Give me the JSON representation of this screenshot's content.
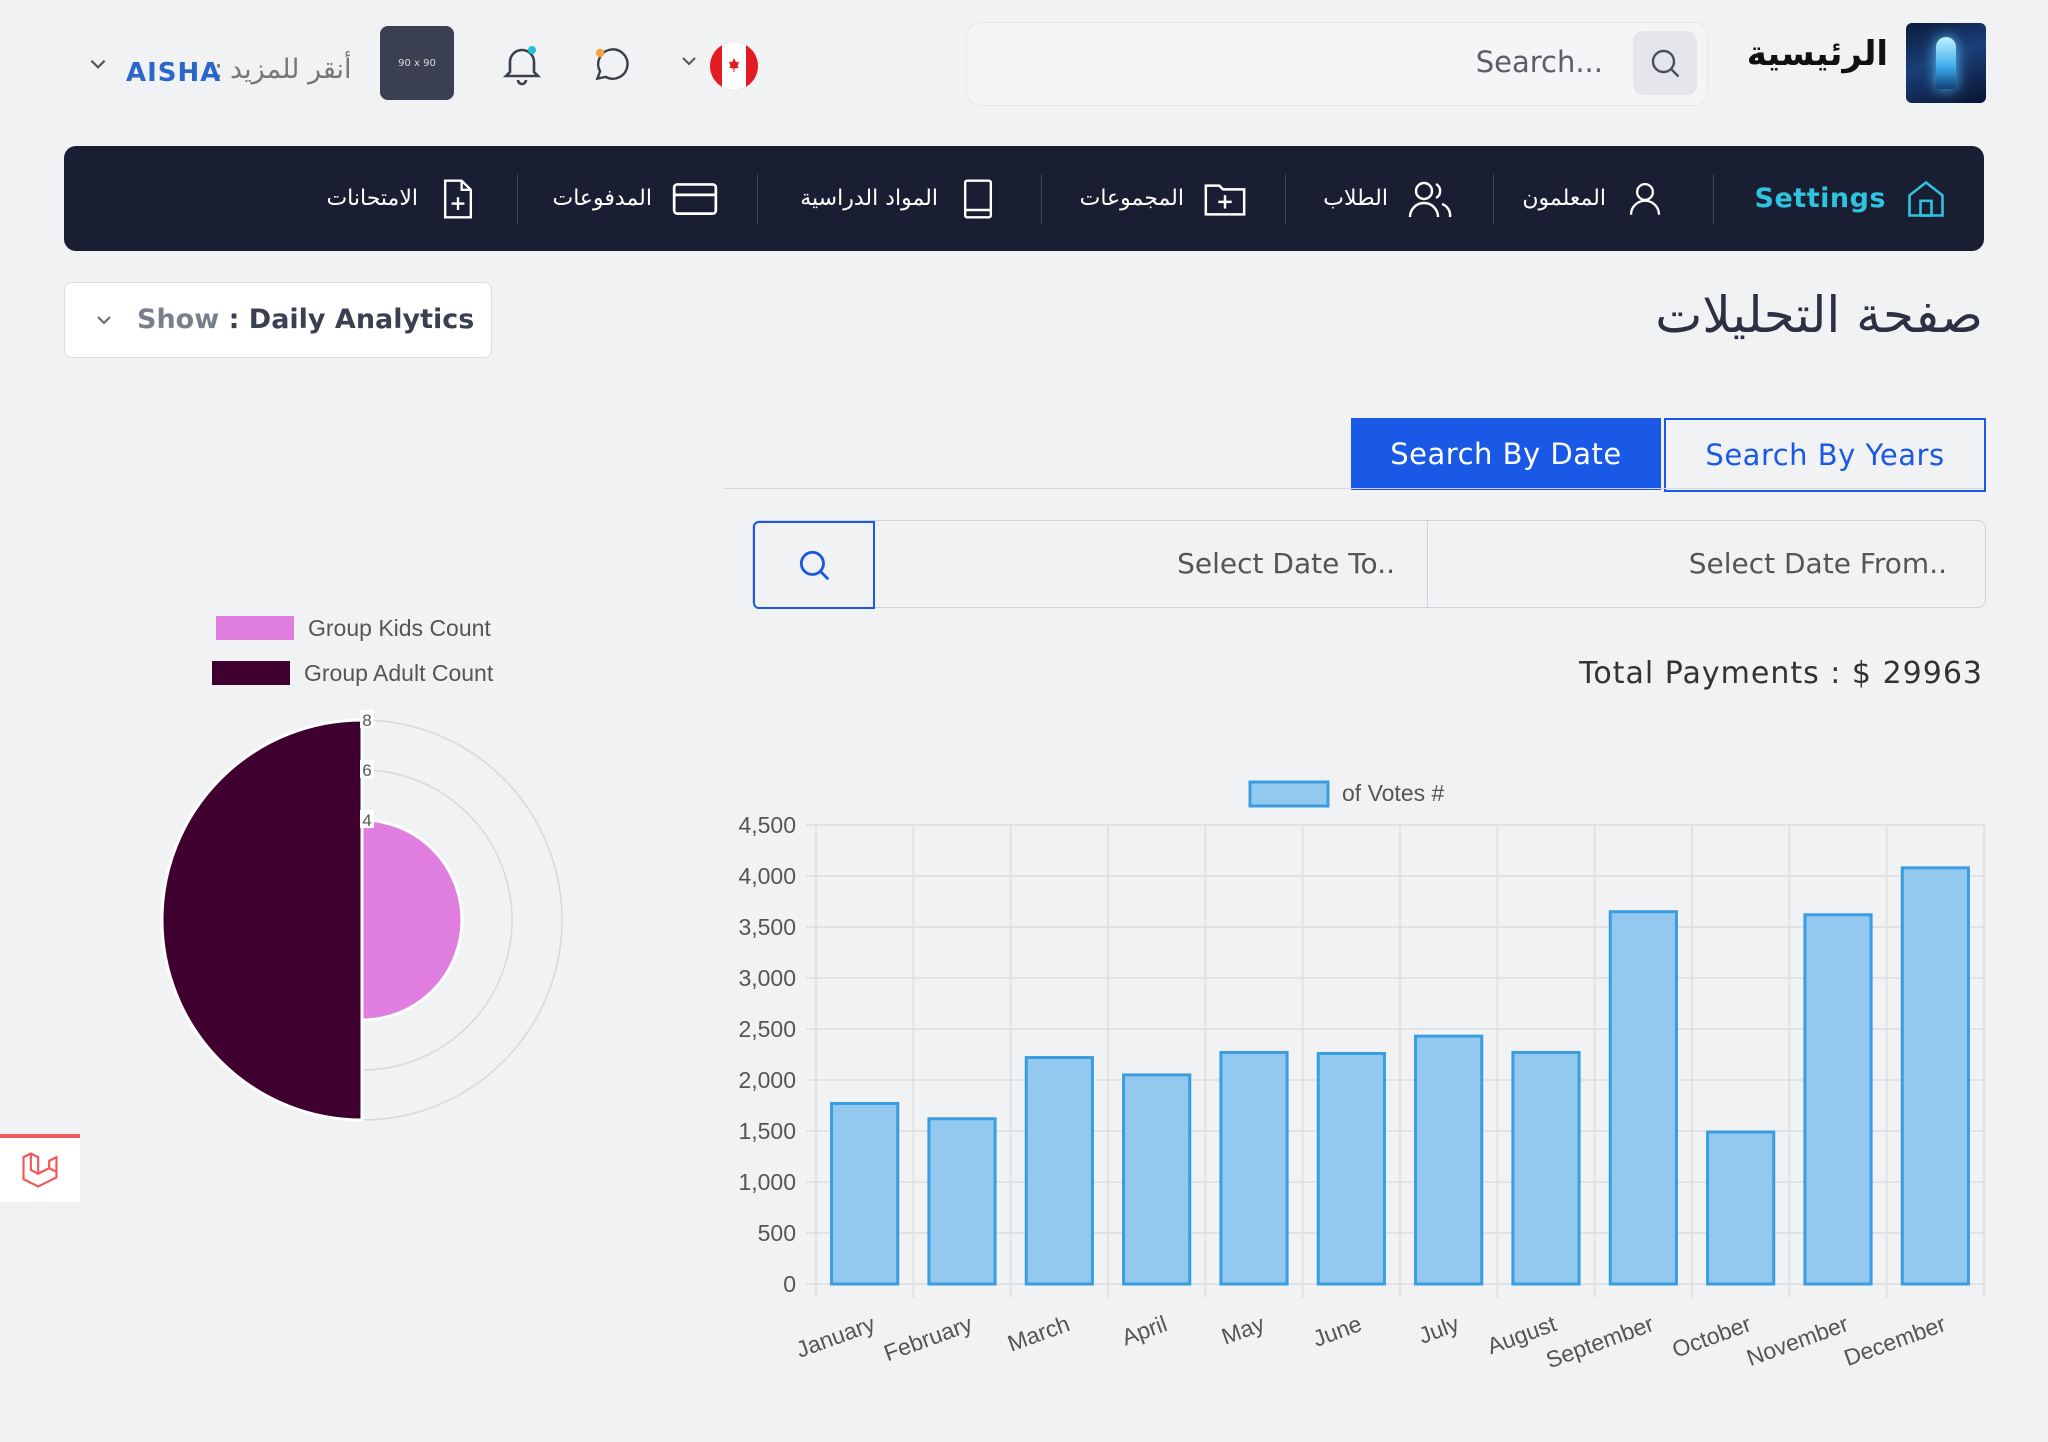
{
  "header": {
    "brand": "الرئيسية",
    "search_placeholder": "Search...",
    "user_prefix": "أنقر للمزيد",
    "user_sep": ":",
    "user_name": "AISHA",
    "avatar_text": "90 x 90",
    "flag_icon": "canada-flag",
    "icons": [
      "search-icon",
      "chat-icon",
      "bell-icon",
      "chevron-down-icon"
    ]
  },
  "nav": {
    "settings": "Settings",
    "teachers": "المعلمون",
    "students": "الطلاب",
    "groups": "المجموعات",
    "subjects": "المواد الدراسية",
    "payments": "المدفوعات",
    "exams": "الامتحانات"
  },
  "page": {
    "title": "صفحة التحليلات",
    "show_label": "Show",
    "show_sep": " : ",
    "show_value": "Daily Analytics"
  },
  "tabs": {
    "by_date": "Search By Date",
    "by_years": "Search By Years"
  },
  "filters": {
    "date_from_placeholder": "Select Date From..",
    "date_to_placeholder": "Select Date To.."
  },
  "summary": {
    "total_label": "Total Payments : $",
    "total_value": "29963"
  },
  "colors": {
    "navbar": "#1a1e33",
    "accent": "#1a58e6",
    "settings": "#2ec4de",
    "bar_fill": "#93c9ef",
    "bar_stroke": "#3a9de1",
    "kids": "#e07ee0",
    "adult": "#3f0030"
  },
  "chart_data": [
    {
      "type": "bar",
      "legend": "of Votes #",
      "categories": [
        "January",
        "February",
        "March",
        "April",
        "May",
        "June",
        "July",
        "August",
        "September",
        "October",
        "November",
        "December"
      ],
      "series": [
        {
          "name": "of Votes #",
          "values": [
            1770,
            1620,
            2220,
            2050,
            2270,
            2260,
            2430,
            2270,
            3650,
            1490,
            3620,
            4080
          ]
        }
      ],
      "ylim": [
        0,
        4500
      ],
      "yticks": [
        "0",
        "500",
        "1,000",
        "1,500",
        "2,000",
        "2,500",
        "3,000",
        "3,500",
        "4,000",
        "4,500"
      ],
      "grid": true,
      "legend_position": "top-center"
    },
    {
      "type": "pie",
      "subtype": "polar-area",
      "legend": [
        "Group Kids Count",
        "Group Adult Count"
      ],
      "series": [
        {
          "name": "Group Kids Count",
          "value": 4
        },
        {
          "name": "Group Adult Count",
          "value": 8
        }
      ],
      "r_ticks": [
        "8",
        "6",
        "4"
      ],
      "r_max": 8,
      "legend_position": "top"
    }
  ]
}
